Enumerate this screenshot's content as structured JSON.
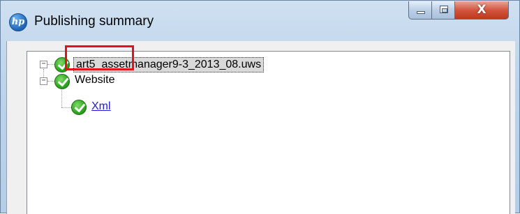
{
  "window": {
    "title": "Publishing summary",
    "app_icon_text": "hp",
    "controls": {
      "minimize": "",
      "maximize": "",
      "close": "X"
    }
  },
  "tree": {
    "root": {
      "label": "art5_assetmanager9-3_2013_08.uws",
      "status": "success",
      "expanded": true,
      "selected": true,
      "children": [
        {
          "label": "Website",
          "status": "success",
          "expanded": true,
          "children": [
            {
              "label": "Xml",
              "status": "success",
              "is_link": true,
              "highlighted": true
            }
          ]
        }
      ]
    }
  },
  "colors": {
    "success": "#2ea51f",
    "highlight": "#e0141c",
    "link": "#1b1bd6",
    "close_button": "#c0391f"
  }
}
